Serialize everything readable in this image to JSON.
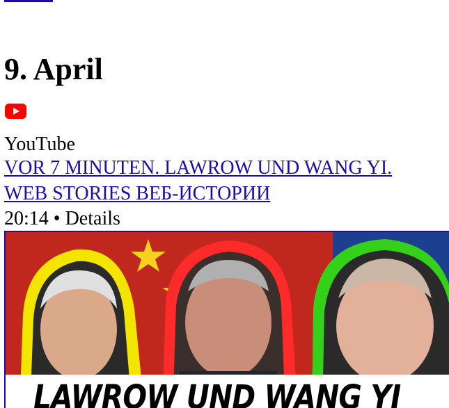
{
  "date_heading": "9. April",
  "source": {
    "icon": "youtube-icon",
    "name": "YouTube"
  },
  "video": {
    "title": "VOR 7 MINUTEN. LAWROW UND WANG YI.",
    "tags": "WEB STORIES ВЕБ-ИСТОРИИ",
    "meta": "20:14 • Details",
    "thumbnail_caption": "LAWROW UND WANG YI"
  },
  "colors": {
    "link": "#1a0dab",
    "youtube_red": "#ff0000"
  }
}
